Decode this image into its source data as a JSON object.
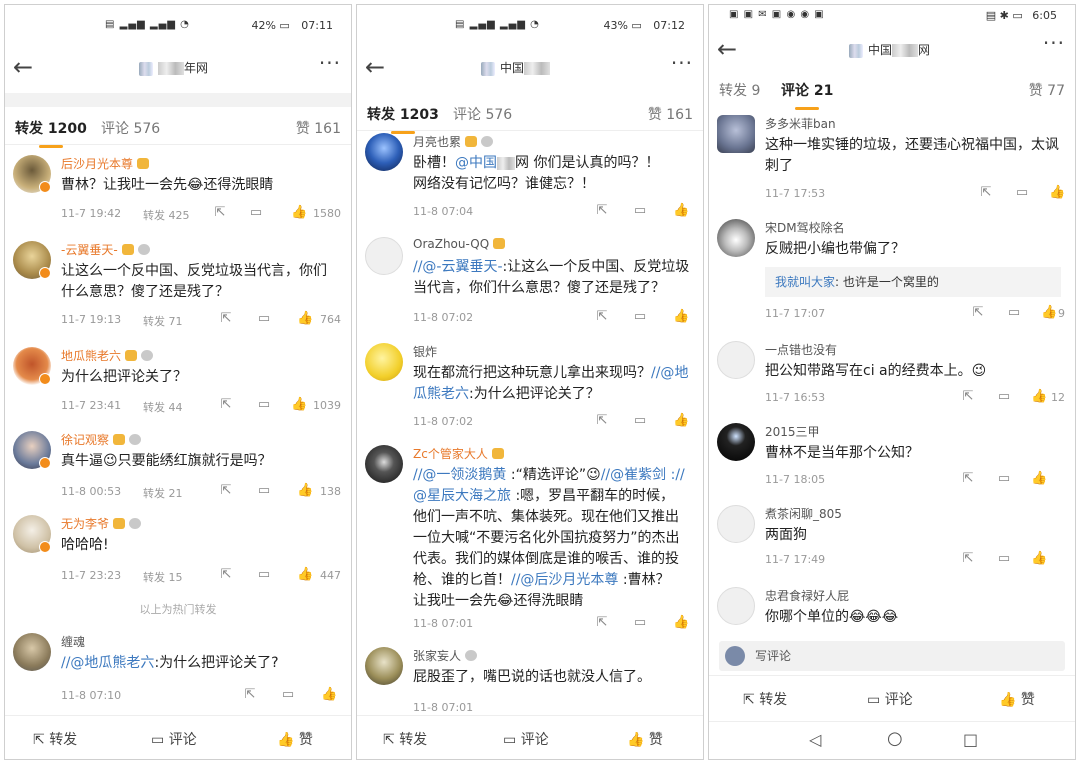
{
  "screen_width": 1080,
  "screen_height": 764,
  "icons": {
    "back": "back-arrow-icon",
    "more": "more-icon",
    "repost": "repost-icon",
    "comment": "comment-icon",
    "like": "thumbs-up-icon"
  },
  "colors": {
    "accent": "#f7a11a",
    "name_orange": "#e8792b",
    "link": "#3d79bf"
  },
  "panel1": {
    "status_time": "07:11",
    "status_battery": "42%",
    "title_suffix": "年网",
    "tabs": {
      "repost": "转发 1200",
      "comment": "评论 576",
      "like": "赞 161"
    },
    "items": [
      {
        "name": "后沙月光本尊",
        "text": "曹林？让我吐一会先😂还得洗眼睛",
        "time": "11-7 19:42",
        "repost": "转发 425",
        "likes": "1580"
      },
      {
        "name": "-云翼垂天-",
        "text": "让这么一个反中国、反党垃圾当代言，你们什么意思？傻了还是残了？",
        "time": "11-7 19:13",
        "repost": "转发 71",
        "likes": "764"
      },
      {
        "name": "地瓜熊老六",
        "text": "为什么把评论关了？",
        "time": "11-7 23:41",
        "repost": "转发 44",
        "likes": "1039"
      },
      {
        "name": "徐记观察",
        "text": "真牛逼😉只要能绣红旗就行是吗？",
        "time": "11-8 00:53",
        "repost": "转发 21",
        "likes": "138"
      },
      {
        "name": "无为李爷",
        "text": "哈哈哈!",
        "time": "11-7 23:23",
        "repost": "转发 15",
        "likes": "447"
      }
    ],
    "divider": "以上为热门转发",
    "last": {
      "name": "缠魂",
      "link": "//@地瓜熊老六",
      "text": ":为什么把评论关了?",
      "time": "11-8 07:10"
    },
    "bottom": {
      "repost": "转发",
      "comment": "评论",
      "like": "赞"
    }
  },
  "panel2": {
    "status_time": "07:12",
    "status_battery": "43%",
    "title_prefix": "中国",
    "tabs": {
      "repost": "转发 1203",
      "comment": "评论 576",
      "like": "赞 161"
    },
    "items": [
      {
        "name": "月亮也累",
        "l1a": "卧槽！",
        "l1link": "@中国",
        "l1b": "网 你们是认真的吗？！",
        "l2": "网络没有记忆吗？谁健忘？！",
        "time": "11-8 07:04"
      },
      {
        "name": "OraZhou-QQ",
        "link": "//@-云翼垂天-",
        "t1": ":让这么一个反中国、反党垃",
        "t2": "圾当代言，你们什么意思？傻了还是残了？",
        "time": "11-8 07:02"
      },
      {
        "name": "银炸",
        "t1": "现在都流行把这种玩意儿拿出来现吗？",
        "link1": "//@",
        "link2": "地瓜熊老六",
        "t2": ":为什么把评论关了？",
        "time": "11-8 07:02"
      },
      {
        "name": "Zc个管家大人",
        "lines": [
          {
            "link": "//@一领淡鹅黄",
            "rest": " :“精选评论”😉"
          },
          {
            "link": "@星辰大海之旅",
            "rest": " :嗯，罗昌平翻车的时候，"
          }
        ],
        "l1c": "//@崔紫剑 ://",
        "l3": "他们一声不吭、集体装死。现在他们又推出",
        "l4": "一位大喊“不要污名化外国抗疫努力”的杰出",
        "l5": "代表。我们的媒体倒底是谁的喉舌、谁的投",
        "l6a": "枪、谁的匕首！",
        "l6link": "//@后沙月光本尊",
        "l6b": " :曹林？",
        "l7": "让我吐一会先😂还得洗眼睛",
        "time": "11-8 07:01"
      },
      {
        "name": "张家妄人",
        "text": "屁股歪了，嘴巴说的话也就没人信了。",
        "time": "11-8 07:01"
      }
    ],
    "bottom": {
      "repost": "转发",
      "comment": "评论",
      "like": "赞"
    }
  },
  "panel3": {
    "status_time": "6:05",
    "title_prefix": "中国",
    "title_suffix": "网",
    "tabs": {
      "repost": "转发 9",
      "comment": "评论 21",
      "like": "赞 77"
    },
    "items": [
      {
        "name": "多多米菲ban",
        "t1": "这种一堆实锤的垃圾，还要违心祝福中国，太讽",
        "t2": "刺了",
        "time": "11-7 17:53",
        "likes": ""
      },
      {
        "name": "宋DM驾校除名",
        "text": "反贼把小编也带偏了？",
        "quote_name": "我就叫大家",
        "quote_text": ": 也许是一个窝里的",
        "time": "11-7 17:07",
        "likes": "9"
      },
      {
        "name": "一点错也没有",
        "text": "把公知带路写在ci a的经费本上。😉",
        "time": "11-7 16:53",
        "likes": "12"
      },
      {
        "name": "2015三甲",
        "text": "曹林不是当年那个公知？",
        "time": "11-7 18:05",
        "likes": ""
      },
      {
        "name": "煮茶闲聊_805",
        "text": "两面狗",
        "time": "11-7 17:49",
        "likes": ""
      },
      {
        "name": "忠君食禄好人屁",
        "text": "你哪个单位的😂😂😂",
        "time": "",
        "likes": ""
      }
    ],
    "write": "写评论",
    "bottom": {
      "repost": "转发",
      "comment": "评论",
      "like": "赞"
    }
  }
}
